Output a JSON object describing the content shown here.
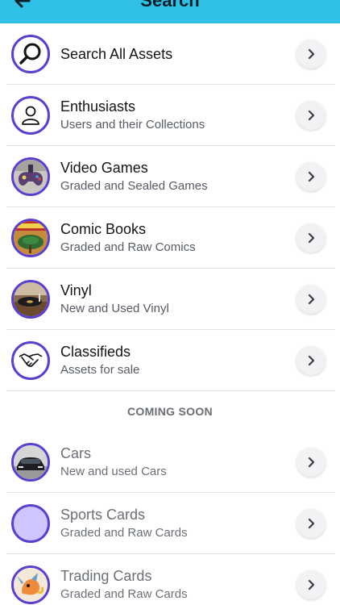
{
  "header": {
    "title": "Search",
    "back_icon": "back-arrow-icon"
  },
  "items": [
    {
      "name": "Search All Assets",
      "sub": "",
      "icon": "magnifier-icon"
    },
    {
      "name": "Enthusiasts",
      "sub": "Users and their Collections",
      "icon": "user-icon"
    },
    {
      "name": "Video Games",
      "sub": "Graded and Sealed Games",
      "icon": "video-games-image"
    },
    {
      "name": "Comic Books",
      "sub": "Graded and Raw Comics",
      "icon": "comic-books-image"
    },
    {
      "name": "Vinyl",
      "sub": "New and Used Vinyl",
      "icon": "vinyl-image"
    },
    {
      "name": "Classifieds",
      "sub": "Assets for sale",
      "icon": "handshake-icon"
    }
  ],
  "coming_soon": {
    "label": "COMING SOON",
    "items": [
      {
        "name": "Cars",
        "sub": "New and used Cars",
        "icon": "car-image"
      },
      {
        "name": "Sports Cards",
        "sub": "Graded and Raw Cards",
        "icon": "sports-cards-placeholder"
      },
      {
        "name": "Trading Cards",
        "sub": "Graded and Raw Cards",
        "icon": "trading-cards-image"
      }
    ]
  },
  "colors": {
    "header_bg": "#2fc0e6",
    "avatar_ring": "#5a3fd1",
    "placeholder_fill": "#cfc6ff"
  }
}
